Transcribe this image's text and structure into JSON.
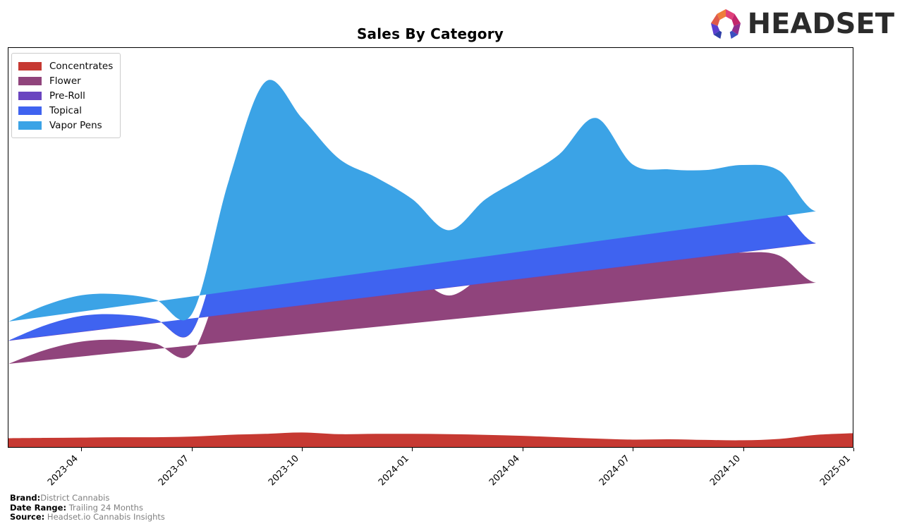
{
  "header": {
    "title": "Sales By Category",
    "logo_text": "HEADSET",
    "logo_icon": "headset-polygon-logo"
  },
  "footer": {
    "brand_label": "Brand:",
    "brand_value": "District Cannabis",
    "date_range_label": "Date Range:",
    "date_range_value": "Trailing 24 Months",
    "source_label": "Source:",
    "source_value": "Headset.io Cannabis Insights"
  },
  "legend": {
    "position": "upper-left",
    "items": [
      {
        "label": "Concentrates",
        "color": "#c63932"
      },
      {
        "label": "Flower",
        "color": "#90447c"
      },
      {
        "label": "Pre-Roll",
        "color": "#6a45c0"
      },
      {
        "label": "Topical",
        "color": "#3f63f0"
      },
      {
        "label": "Vapor Pens",
        "color": "#3ba3e6"
      }
    ]
  },
  "chart_data": {
    "type": "area",
    "stacked": true,
    "title": "Sales By Category",
    "xlabel": "",
    "ylabel": "",
    "grid": false,
    "legend_position": "upper-left",
    "x": [
      "2023-02",
      "2023-03",
      "2023-04",
      "2023-05",
      "2023-06",
      "2023-07",
      "2023-08",
      "2023-09",
      "2023-10",
      "2023-11",
      "2023-12",
      "2024-01",
      "2024-02",
      "2024-03",
      "2024-04",
      "2024-05",
      "2024-06",
      "2024-07",
      "2024-08",
      "2024-09",
      "2024-10",
      "2024-11",
      "2024-12",
      "2025-01"
    ],
    "xticks": [
      "2023-04",
      "2023-07",
      "2023-10",
      "2024-01",
      "2024-04",
      "2024-07",
      "2024-10",
      "2025-01"
    ],
    "ylim": [
      0,
      118
    ],
    "yticks_visible": false,
    "units": "relative sales index",
    "series": [
      {
        "name": "Concentrates",
        "color": "#c63932",
        "values": [
          2.6,
          2.7,
          2.8,
          2.9,
          2.9,
          3.1,
          3.6,
          3.9,
          4.3,
          3.8,
          3.9,
          3.9,
          3.8,
          3.6,
          3.3,
          2.9,
          2.5,
          2.2,
          2.3,
          2.1,
          2.0,
          2.4,
          3.6,
          4.1
        ]
      },
      {
        "name": "Flower",
        "color": "#90447c",
        "values": [
          22.0,
          26.0,
          28.4,
          28.8,
          27.7,
          24.6,
          52.0,
          72.0,
          64.0,
          56.0,
          52.0,
          47.5,
          41.0,
          47.5,
          52.0,
          57.0,
          64.8,
          55.5,
          54.5,
          54.5,
          55.5,
          54.2,
          45.0,
          50.0,
          62.0
        ]
      },
      {
        "name": "Pre-Roll",
        "color": "#6a45c0",
        "values": [
          6.8,
          7.2,
          7.5,
          7.4,
          7.1,
          6.4,
          12.6,
          17.6,
          15.8,
          14.0,
          13.1,
          12.0,
          10.6,
          12.2,
          13.4,
          14.6,
          16.4,
          14.2,
          13.9,
          13.9,
          14.2,
          13.8,
          11.6,
          12.8,
          15.8
        ]
      },
      {
        "name": "Topical",
        "color": "#3f63f0",
        "values": [
          0.1,
          0.1,
          0.1,
          0.1,
          0.1,
          0.1,
          0.1,
          0.2,
          0.2,
          0.1,
          0.1,
          0.1,
          0.1,
          0.1,
          0.1,
          0.1,
          0.2,
          0.1,
          0.1,
          0.1,
          0.1,
          0.1,
          0.1,
          0.1,
          0.1
        ]
      },
      {
        "name": "Vapor Pens",
        "color": "#3ba3e6",
        "values": [
          5.6,
          5.9,
          6.1,
          6.0,
          5.8,
          5.2,
          10.4,
          14.3,
          12.9,
          11.4,
          10.7,
          9.8,
          8.6,
          9.9,
          10.9,
          11.9,
          13.4,
          11.6,
          11.3,
          11.3,
          11.6,
          11.2,
          9.4,
          10.4,
          12.9
        ]
      }
    ]
  }
}
